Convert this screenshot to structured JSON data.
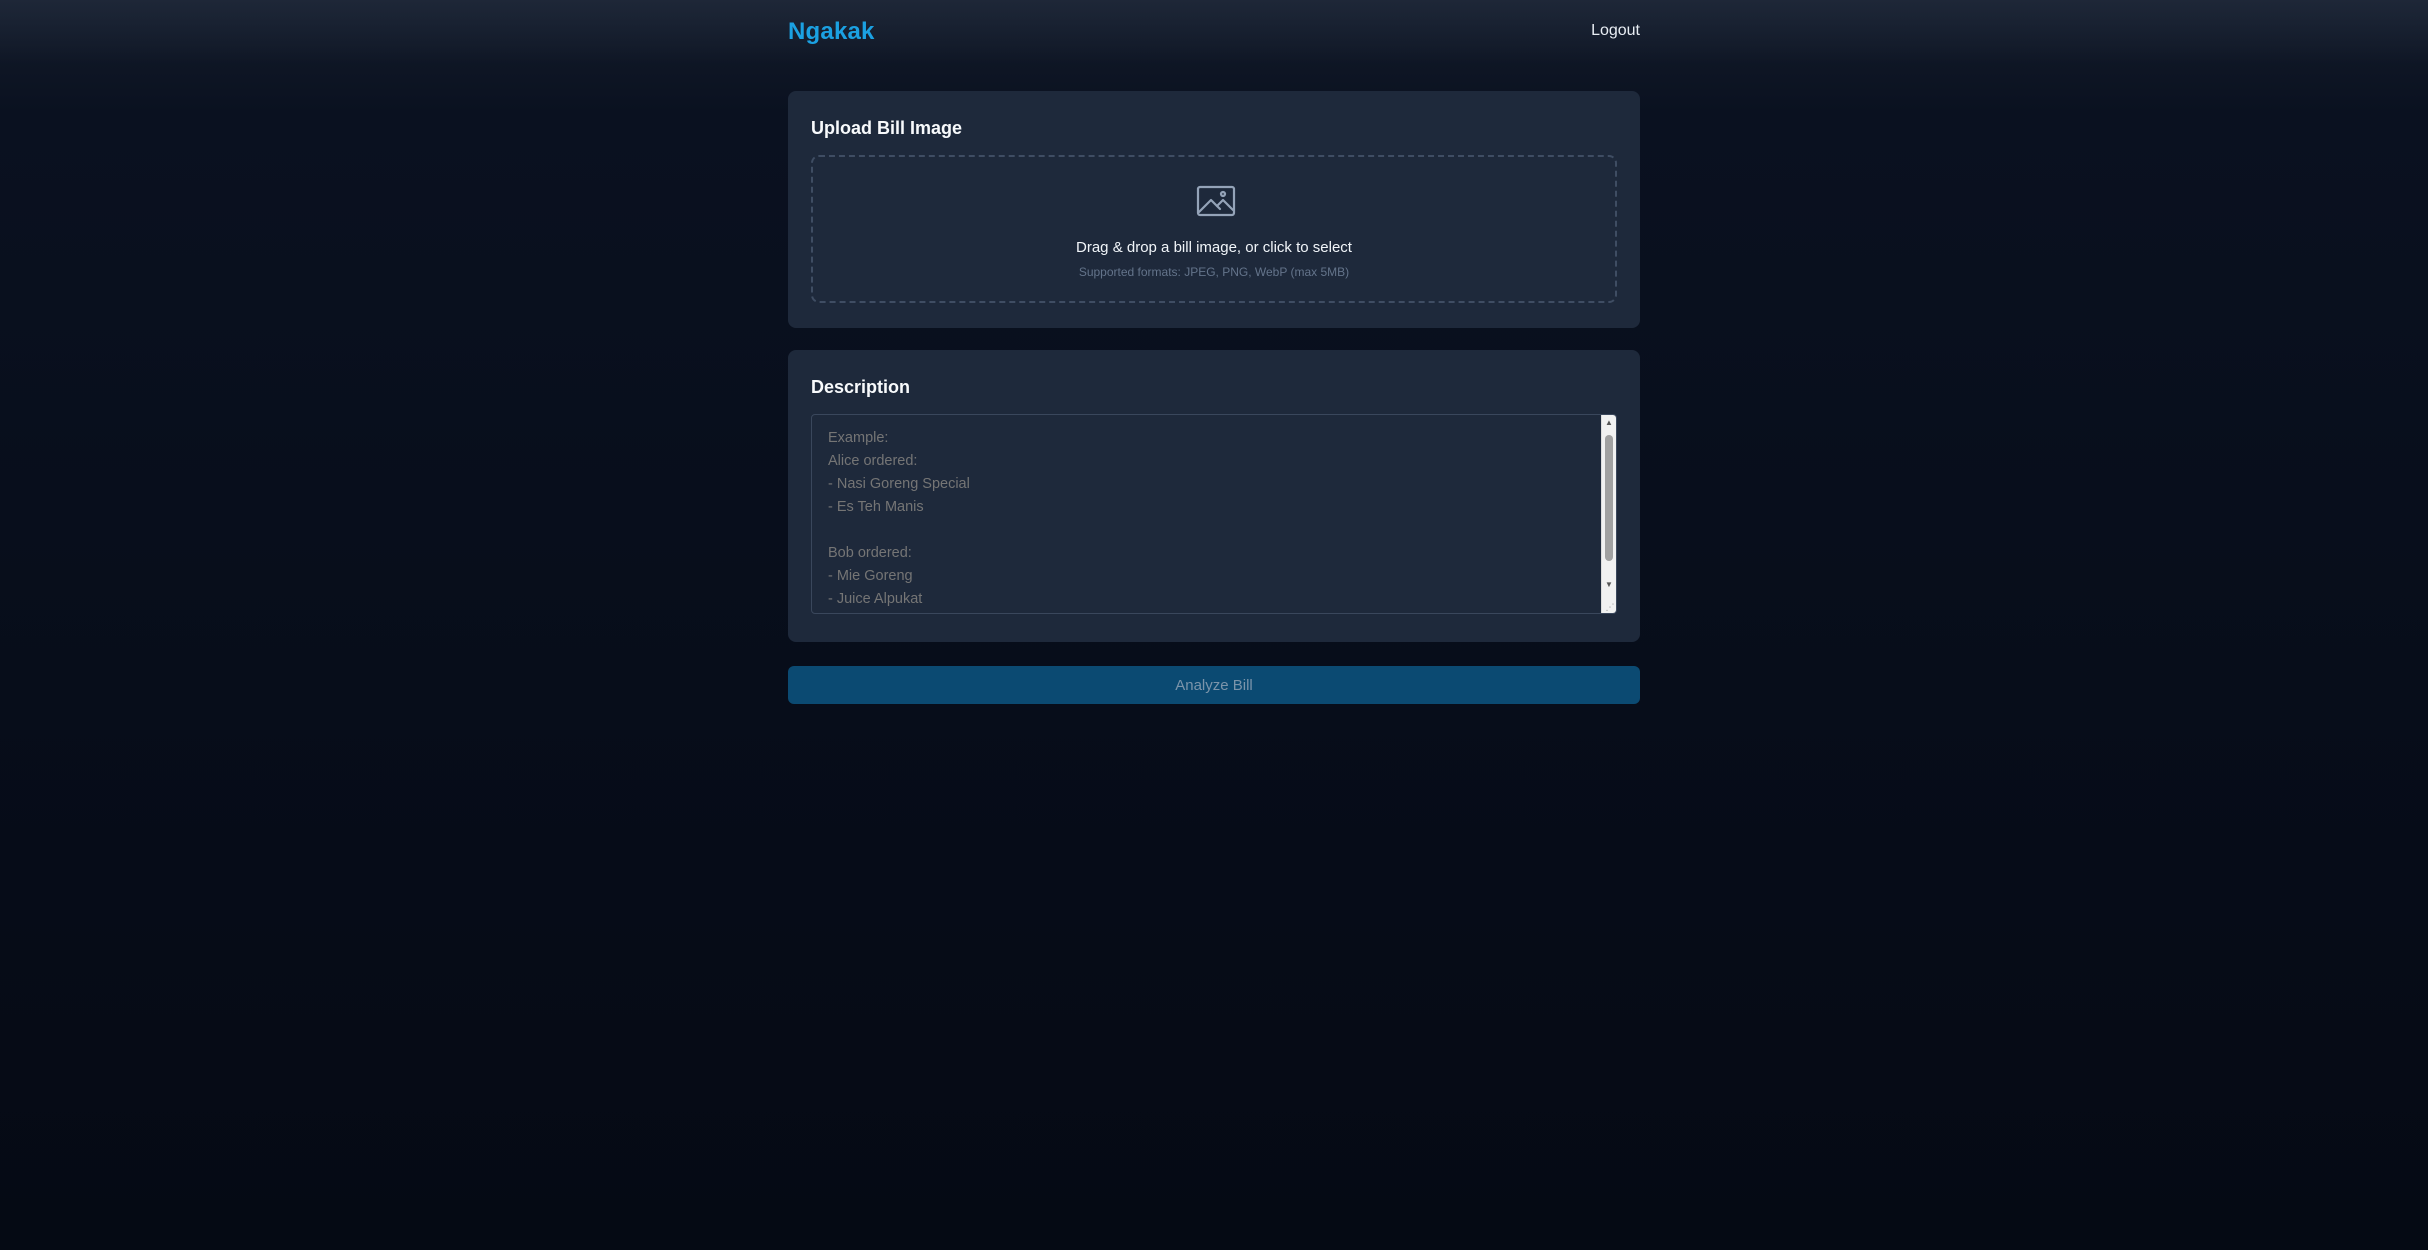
{
  "header": {
    "brand": "Ngakak",
    "logout_label": "Logout"
  },
  "upload": {
    "title": "Upload Bill Image",
    "icon": "image-icon",
    "main_text": "Drag & drop a bill image, or click to select",
    "sub_text": "Supported formats: JPEG, PNG, WebP (max 5MB)"
  },
  "description": {
    "title": "Description",
    "placeholder": "Example:\nAlice ordered:\n- Nasi Goreng Special\n- Es Teh Manis\n\nBob ordered:\n- Mie Goreng\n- Juice Alpukat\n- Es Kelapa",
    "value": ""
  },
  "actions": {
    "analyze_label": "Analyze Bill",
    "analyze_enabled": false
  },
  "colors": {
    "brand": "#1ba1e2",
    "card": "#1e293b",
    "button": "#0b4a72"
  }
}
